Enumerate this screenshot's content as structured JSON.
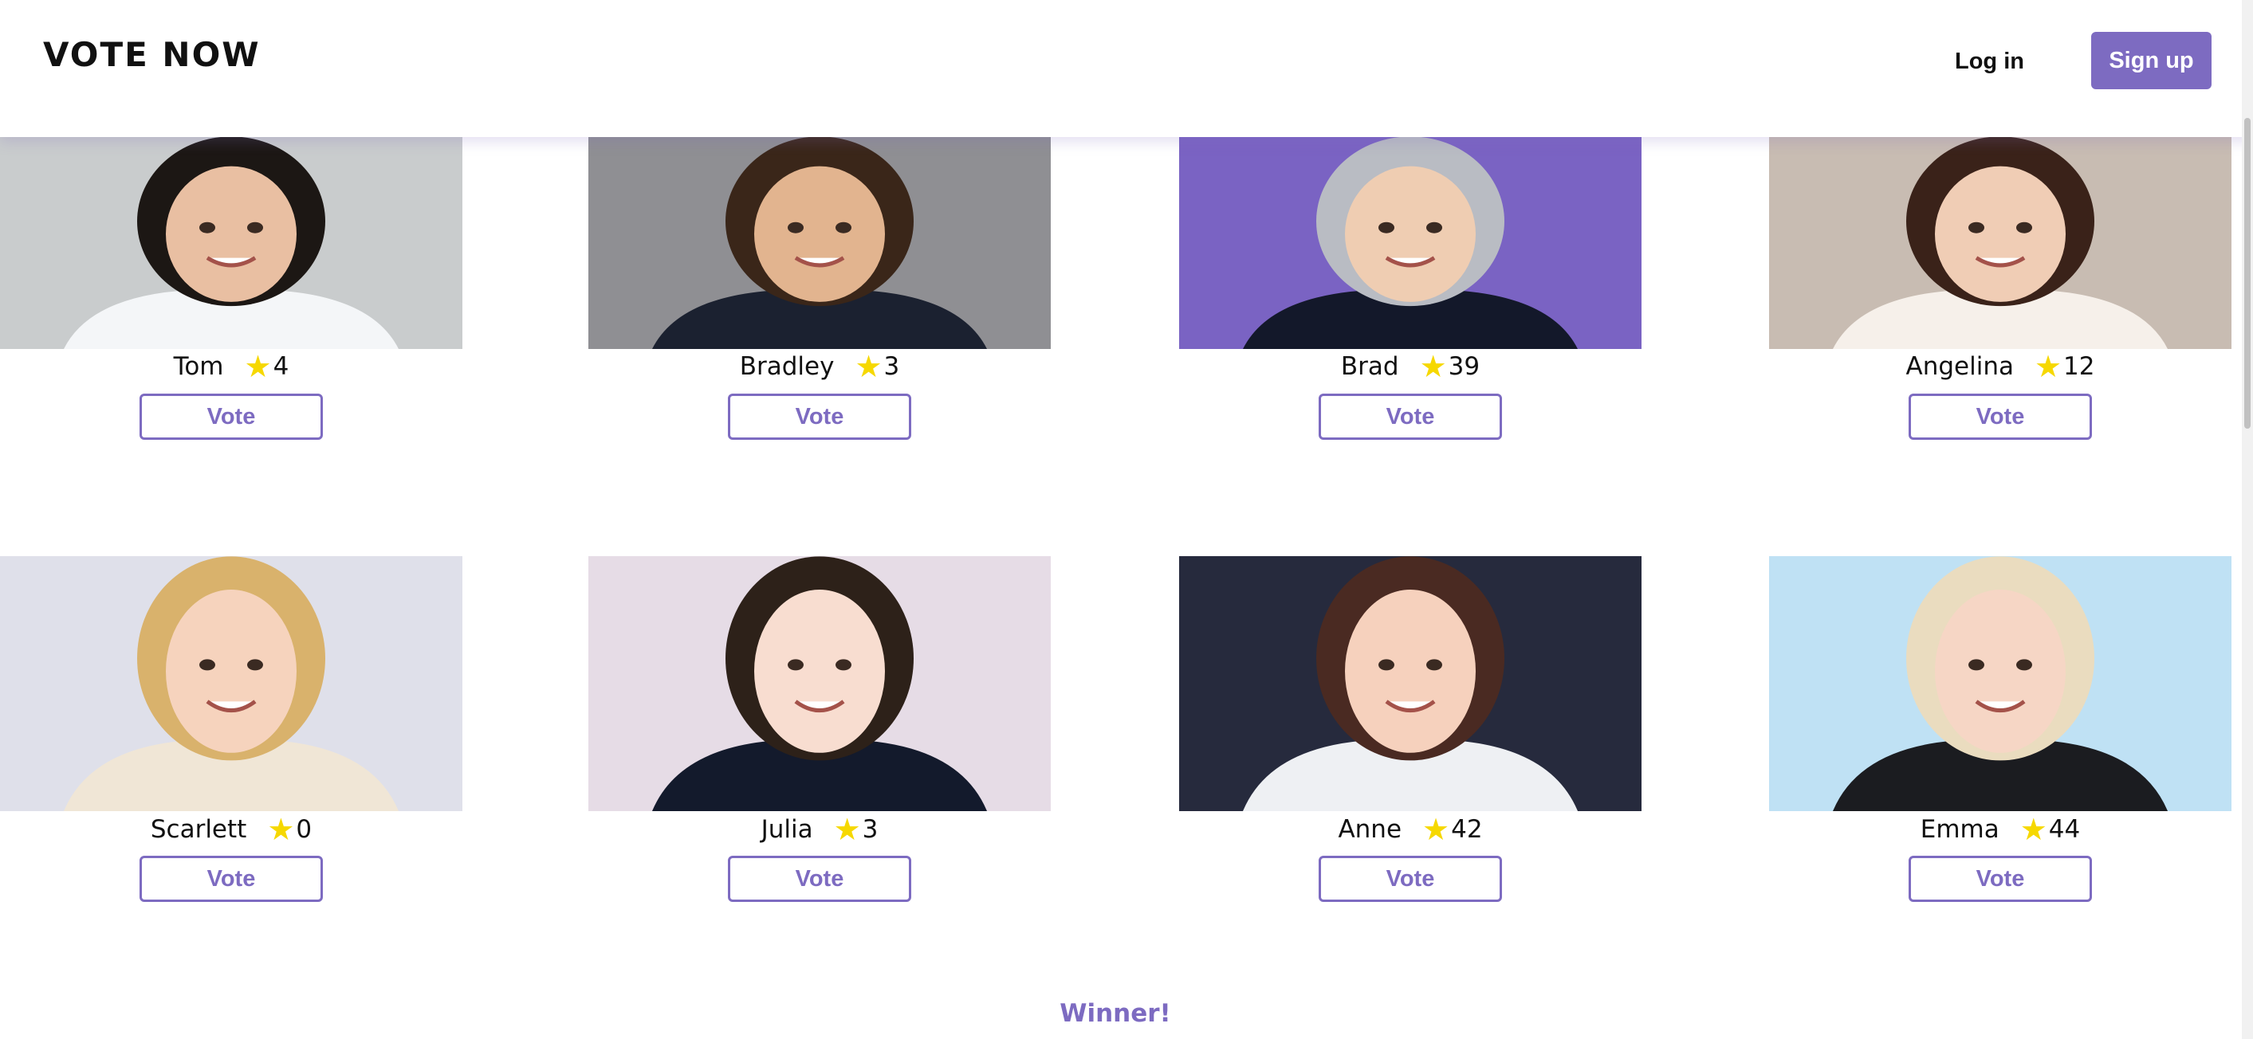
{
  "header": {
    "brand": "VOTE NOW",
    "login_label": "Log in",
    "signup_label": "Sign up"
  },
  "vote_label": "Vote",
  "candidates": [
    {
      "name": "Tom",
      "votes": "4",
      "bg": "#c9cccd",
      "hair": "#1c1714",
      "skin": "#e9bfa2",
      "shirt": "#f4f6f8"
    },
    {
      "name": "Bradley",
      "votes": "3",
      "bg": "#8f8f93",
      "hair": "#3a2619",
      "skin": "#e2b48f",
      "shirt": "#1b2130"
    },
    {
      "name": "Brad",
      "votes": "39",
      "bg": "#7a63c3",
      "hair": "#b9bcc3",
      "skin": "#efcdb2",
      "shirt": "#13182a"
    },
    {
      "name": "Angelina",
      "votes": "12",
      "bg": "#c8bcb2",
      "hair": "#3a2219",
      "skin": "#f0cdb5",
      "shirt": "#f6f0ea"
    },
    {
      "name": "Scarlett",
      "votes": "0",
      "bg": "#dfe0ea",
      "hair": "#d9b26c",
      "skin": "#f6d3bd",
      "shirt": "#f0e6d6"
    },
    {
      "name": "Julia",
      "votes": "3",
      "bg": "#e6dce6",
      "hair": "#2d2119",
      "skin": "#f8ddd0",
      "shirt": "#131a2c"
    },
    {
      "name": "Anne",
      "votes": "42",
      "bg": "#262a3d",
      "hair": "#4a2a22",
      "skin": "#f6d1bd",
      "shirt": "#eef0f3"
    },
    {
      "name": "Emma",
      "votes": "44",
      "bg": "#bfe1f4",
      "hair": "#eadcbf",
      "skin": "#f6d6c5",
      "shirt": "#1b1c20"
    }
  ],
  "winner_label": "Winner!",
  "colors": {
    "accent": "#7d6bc1",
    "star": "#f6d800"
  }
}
